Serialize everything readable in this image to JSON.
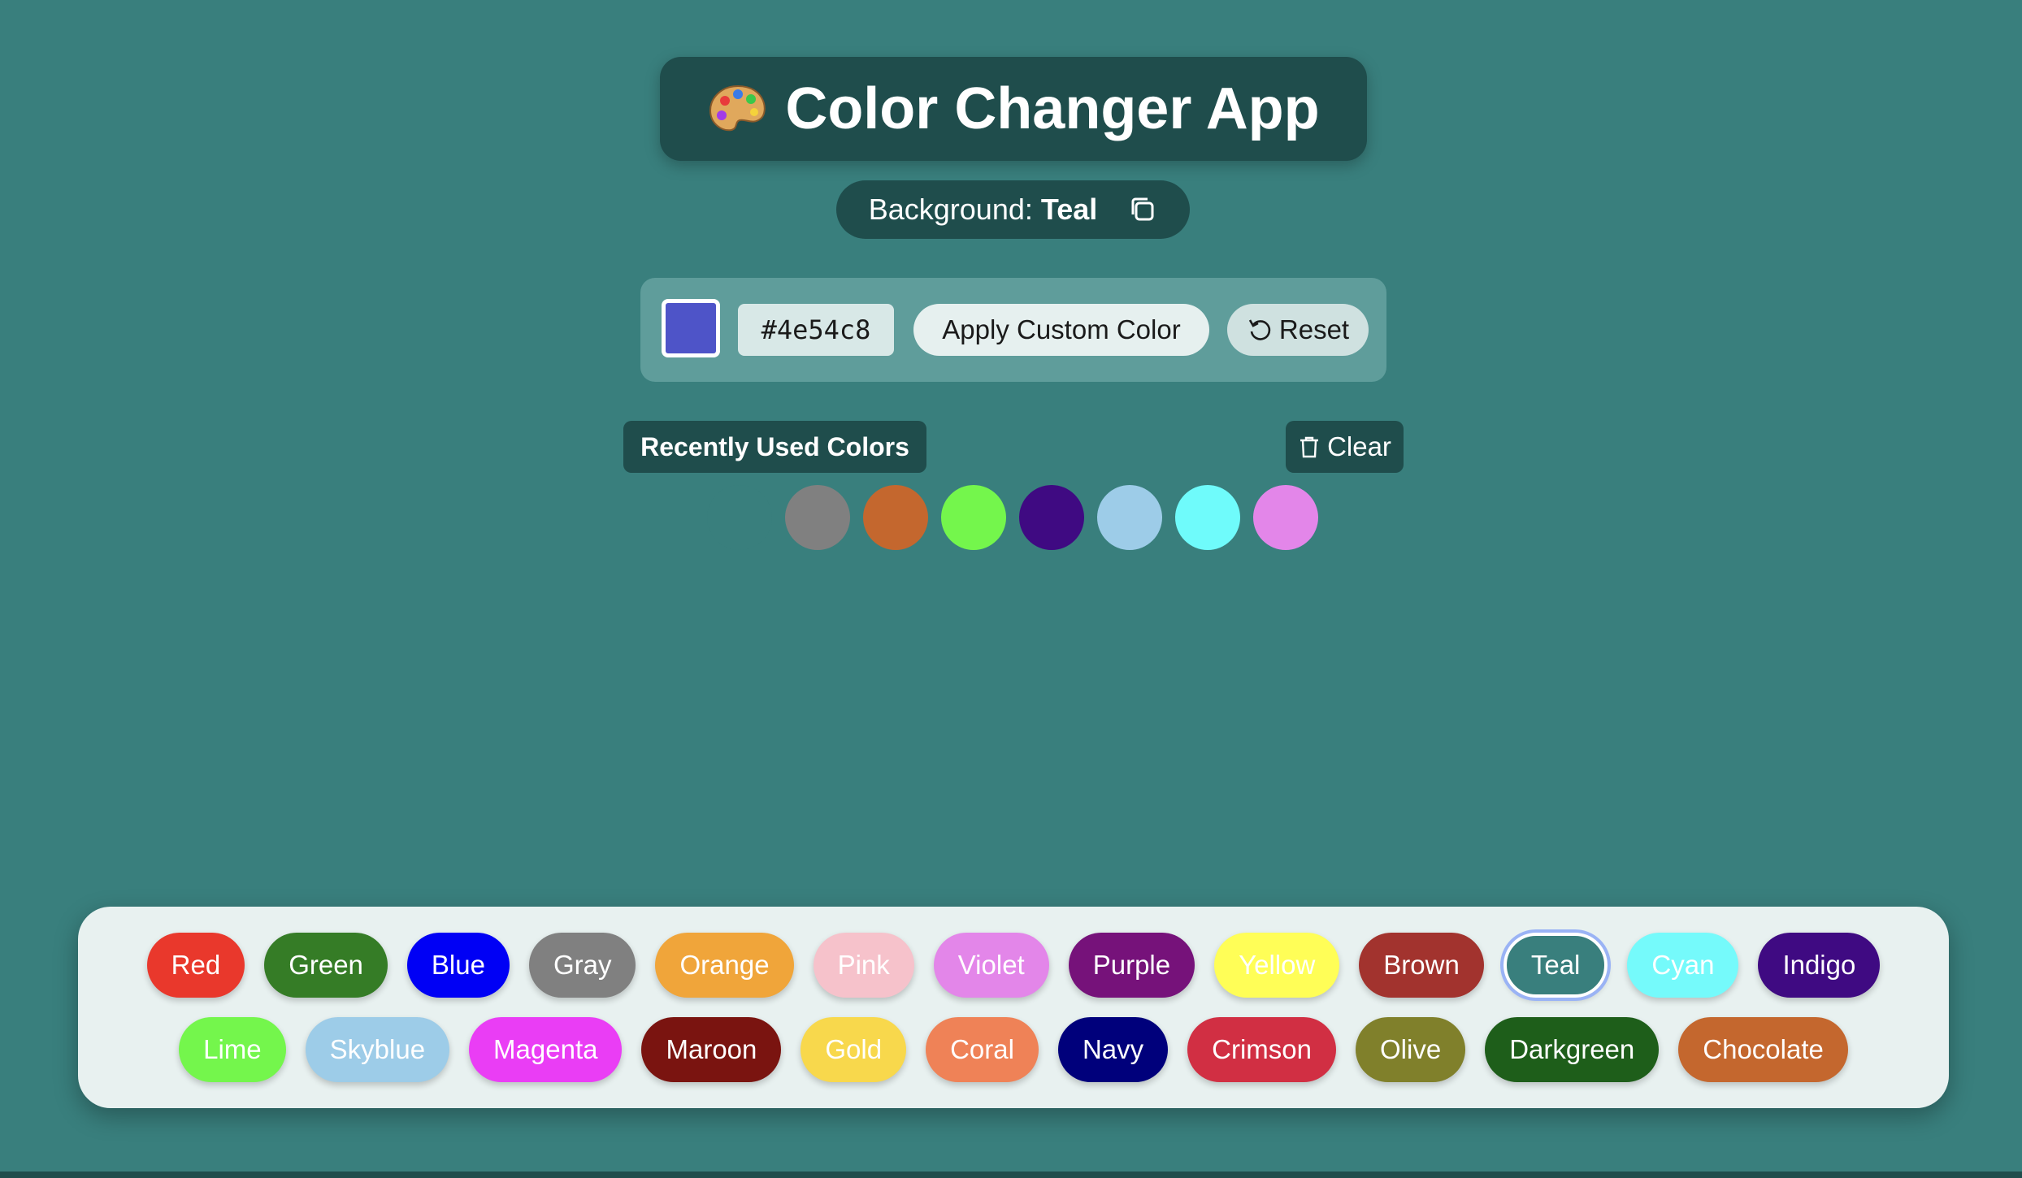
{
  "app": {
    "title": "Color Changer App",
    "title_icon": "palette-icon"
  },
  "background": {
    "label": "Background:",
    "value": "Teal",
    "color": "#397f7d"
  },
  "custom": {
    "swatch_color": "#4e54c8",
    "hex_value": "#4e54c8",
    "apply_label": "Apply Custom Color",
    "reset_label": "Reset"
  },
  "recent": {
    "label": "Recently Used Colors",
    "clear_label": "Clear",
    "colors": [
      "#397f7d",
      "#808080",
      "#c4672e",
      "#74f64c",
      "#3f0a82",
      "#9dcce8",
      "#6ffbfb",
      "#e386e9"
    ]
  },
  "colors": {
    "row1": [
      {
        "label": "Red",
        "bg": "#e9382c",
        "fg": "#ffffff"
      },
      {
        "label": "Green",
        "bg": "#357c26",
        "fg": "#ffffff"
      },
      {
        "label": "Blue",
        "bg": "#0000f5",
        "fg": "#ffffff"
      },
      {
        "label": "Gray",
        "bg": "#808080",
        "fg": "#ffffff"
      },
      {
        "label": "Orange",
        "bg": "#f0a53a",
        "fg": "#ffffff"
      },
      {
        "label": "Pink",
        "bg": "#f6c2cb",
        "fg": "#ffffff"
      },
      {
        "label": "Violet",
        "bg": "#e386e9",
        "fg": "#ffffff"
      },
      {
        "label": "Purple",
        "bg": "#76127a",
        "fg": "#ffffff"
      },
      {
        "label": "Yellow",
        "bg": "#fffe57",
        "fg": "#ffffff"
      },
      {
        "label": "Brown",
        "bg": "#a2332e",
        "fg": "#ffffff"
      },
      {
        "label": "Teal",
        "bg": "#397f7d",
        "fg": "#ffffff",
        "selected": true
      },
      {
        "label": "Cyan",
        "bg": "#75fafb",
        "fg": "#ffffff"
      },
      {
        "label": "Indigo",
        "bg": "#3f0a82",
        "fg": "#ffffff"
      }
    ],
    "row2": [
      {
        "label": "Lime",
        "bg": "#74f64c",
        "fg": "#ffffff"
      },
      {
        "label": "Skyblue",
        "bg": "#9dcce8",
        "fg": "#ffffff"
      },
      {
        "label": "Magenta",
        "bg": "#ea3df5",
        "fg": "#ffffff"
      },
      {
        "label": "Maroon",
        "bg": "#7a1410",
        "fg": "#ffffff"
      },
      {
        "label": "Gold",
        "bg": "#f8d84c",
        "fg": "#ffffff"
      },
      {
        "label": "Coral",
        "bg": "#ef8257",
        "fg": "#ffffff"
      },
      {
        "label": "Navy",
        "bg": "#00007b",
        "fg": "#ffffff"
      },
      {
        "label": "Crimson",
        "bg": "#d12f43",
        "fg": "#ffffff"
      },
      {
        "label": "Olive",
        "bg": "#80802b",
        "fg": "#ffffff"
      },
      {
        "label": "Darkgreen",
        "bg": "#1e5e1a",
        "fg": "#ffffff"
      },
      {
        "label": "Chocolate",
        "bg": "#c4672e",
        "fg": "#ffffff"
      }
    ]
  }
}
